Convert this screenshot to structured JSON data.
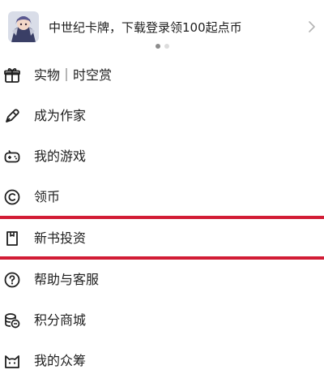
{
  "banner": {
    "text": "中世纪卡牌，下载登录领100起点币",
    "thumb_icon": "game-character-thumbnail",
    "arrow_icon": "chevron-right-icon",
    "dots": 2,
    "active_dot": 0
  },
  "menu": {
    "items": [
      {
        "label": "实物｜时空赏",
        "icon": "gift-icon"
      },
      {
        "label": "成为作家",
        "icon": "pen-icon"
      },
      {
        "label": "我的游戏",
        "icon": "gamepad-icon"
      },
      {
        "label": "领币",
        "icon": "coin-icon"
      },
      {
        "label": "新书投资",
        "icon": "book-icon"
      },
      {
        "label": "帮助与客服",
        "icon": "help-icon"
      },
      {
        "label": "积分商城",
        "icon": "points-icon"
      },
      {
        "label": "我的众筹",
        "icon": "cat-face-icon"
      }
    ]
  },
  "colors": {
    "highlight": "#d21c35",
    "text": "#1e1e1e",
    "dot_inactive": "#dcdcdc",
    "dot_active": "#8c8c8c"
  }
}
